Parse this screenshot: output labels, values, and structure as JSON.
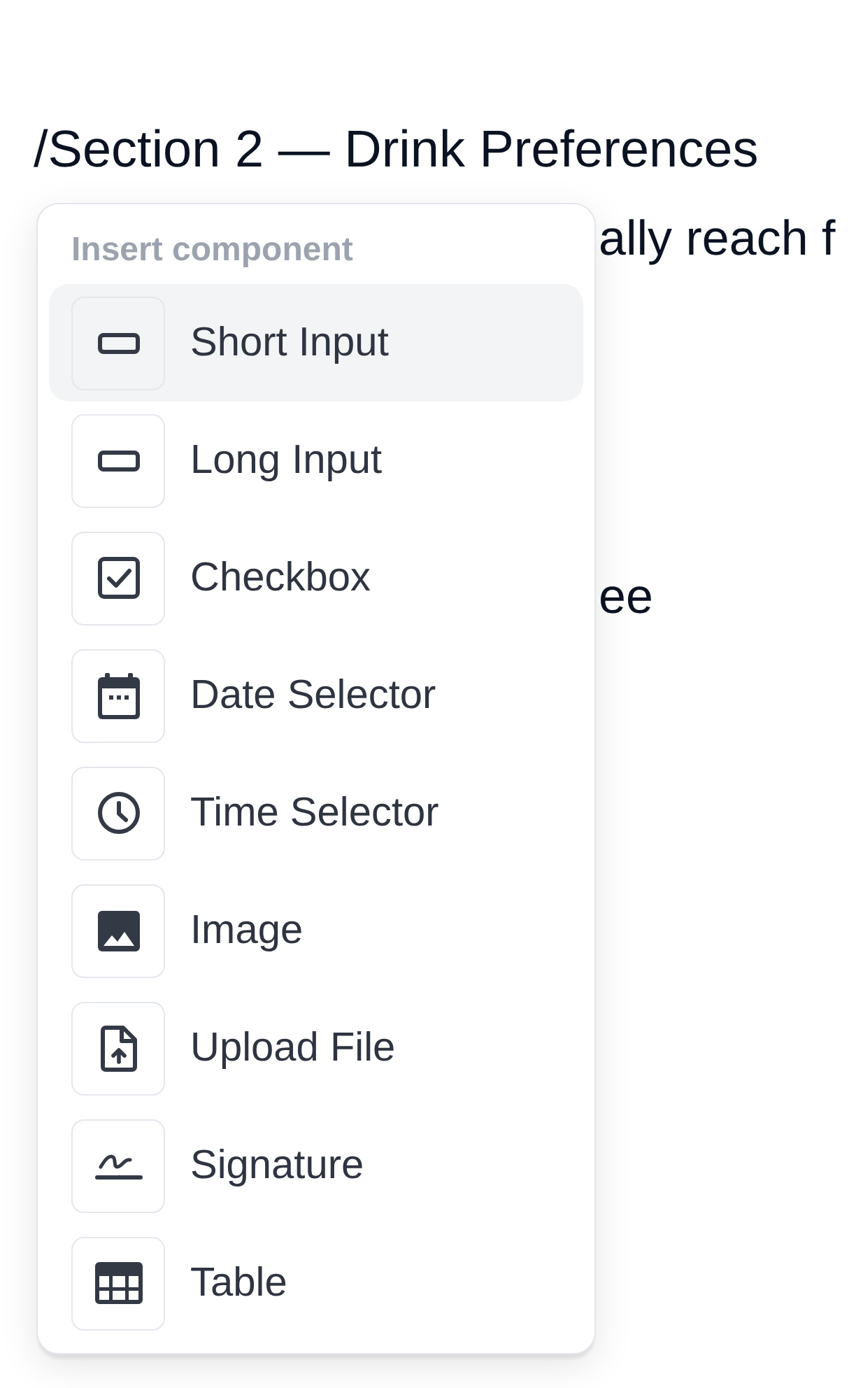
{
  "page": {
    "heading": "/Section 2 — Drink Preferences",
    "lines": [
      "ally reach f",
      "ee"
    ]
  },
  "menu": {
    "title": "Insert component",
    "items": [
      {
        "label": "Short Input",
        "kind": "input",
        "selected": true
      },
      {
        "label": "Long Input",
        "kind": "input",
        "selected": false
      },
      {
        "label": "Checkbox",
        "kind": "checkbox",
        "selected": false
      },
      {
        "label": "Date Selector",
        "kind": "date",
        "selected": false
      },
      {
        "label": "Time Selector",
        "kind": "time",
        "selected": false
      },
      {
        "label": "Image",
        "kind": "image",
        "selected": false
      },
      {
        "label": "Upload File",
        "kind": "upload",
        "selected": false
      },
      {
        "label": "Signature",
        "kind": "signature",
        "selected": false
      },
      {
        "label": "Table",
        "kind": "table",
        "selected": false
      }
    ]
  }
}
